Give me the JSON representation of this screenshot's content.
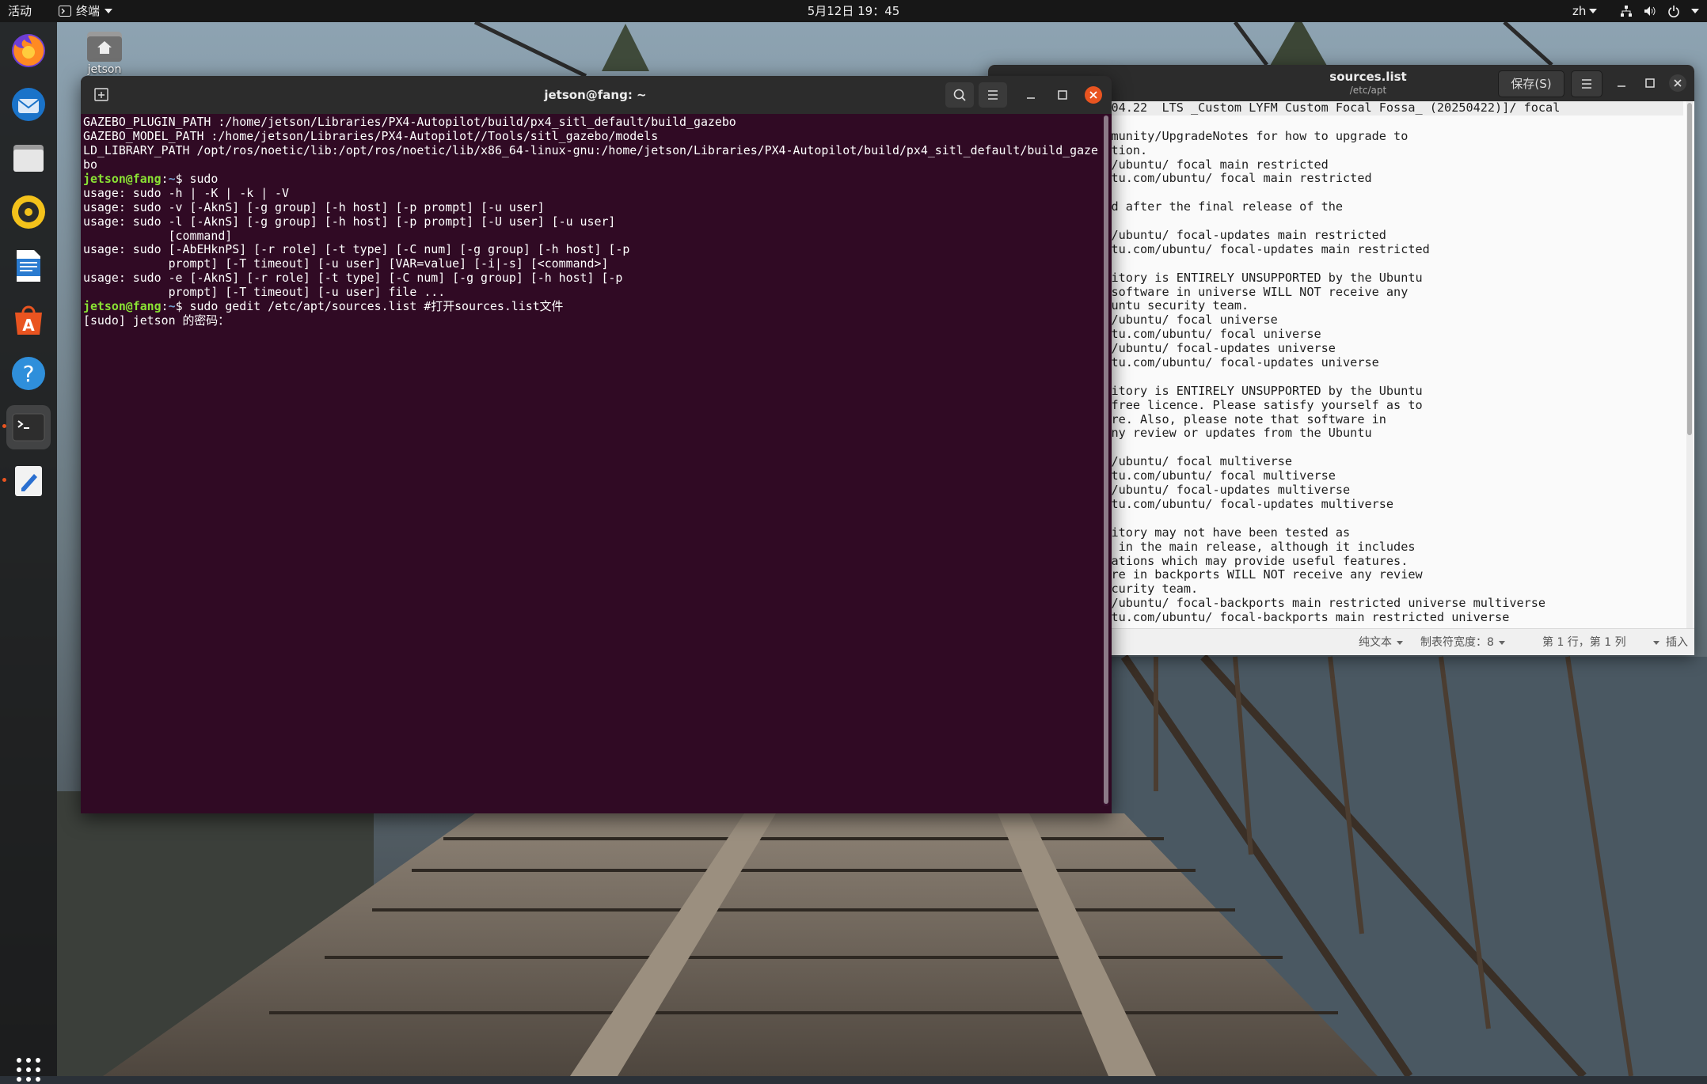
{
  "topbar": {
    "activities": "活动",
    "app_name": "终端",
    "clock": "5月12日 19：45",
    "lang": "zh"
  },
  "desktop": {
    "home_label": "jetson"
  },
  "dock": {
    "items": [
      "firefox-icon",
      "thunderbird-icon",
      "files-icon",
      "rhythmbox-icon",
      "writer-icon",
      "software-icon",
      "help-icon",
      "terminal-icon",
      "text-editor-icon"
    ]
  },
  "terminal": {
    "title": "jetson@fang: ~",
    "lines": [
      {
        "text": "GAZEBO_PLUGIN_PATH :/home/jetson/Libraries/PX4-Autopilot/build/px4_sitl_default/build_gazebo"
      },
      {
        "text": "GAZEBO_MODEL_PATH :/home/jetson/Libraries/PX4-Autopilot//Tools/sitl_gazebo/models"
      },
      {
        "text": "LD_LIBRARY_PATH /opt/ros/noetic/lib:/opt/ros/noetic/lib/x86_64-linux-gnu:/home/jetson/Libraries/PX4-Autopilot/build/px4_sitl_default/build_gaze"
      },
      {
        "text": "bo"
      },
      {
        "prompt": "jetson@fang",
        "path": "~",
        "cmd": "$ sudo"
      },
      {
        "text": "usage: sudo -h | -K | -k | -V"
      },
      {
        "text": "usage: sudo -v [-AknS] [-g group] [-h host] [-p prompt] [-u user]"
      },
      {
        "text": "usage: sudo -l [-AknS] [-g group] [-h host] [-p prompt] [-U user] [-u user]"
      },
      {
        "text": "            [command]"
      },
      {
        "text": "usage: sudo [-AbEHknPS] [-r role] [-t type] [-C num] [-g group] [-h host] [-p"
      },
      {
        "text": "            prompt] [-T timeout] [-u user] [VAR=value] [-i|-s] [<command>]"
      },
      {
        "text": "usage: sudo -e [-AknS] [-r role] [-t type] [-C num] [-g group] [-h host] [-p"
      },
      {
        "text": "            prompt] [-T timeout] [-u user] file ..."
      },
      {
        "prompt": "jetson@fang",
        "path": "~",
        "cmd": "$ sudo gedit /etc/apt/sources.list #打开sources.list文件"
      },
      {
        "text": "[sudo] jetson 的密码："
      }
    ]
  },
  "gedit": {
    "title": "sources.list",
    "subtitle": "/etc/apt",
    "save_label": "保存(S)",
    "lines": [
      "ntu 20.04.6 2025.04.22  LTS _Custom LYFM Custom Focal Fossa_ (20250422)]/ focal",
      "",
      "lp.ubuntu.com/community/UpgradeNotes for how to upgrade to",
      "s of the distribution.",
      "rchive.ubuntu.com/ubuntu/ focal main restricted",
      "//cn.archive.ubuntu.com/ubuntu/ focal main restricted",
      "",
      "x updates produced after the final release of the",
      ".",
      "rchive.ubuntu.com/ubuntu/ focal-updates main restricted",
      "//cn.archive.ubuntu.com/ubuntu/ focal-updates main restricted",
      "",
      "e from this repository is ENTIRELY UNSUPPORTED by the Ubuntu",
      "please note that software in universe WILL NOT receive any",
      "dates from the Ubuntu security team.",
      "rchive.ubuntu.com/ubuntu/ focal universe",
      "//cn.archive.ubuntu.com/ubuntu/ focal universe",
      "rchive.ubuntu.com/ubuntu/ focal-updates universe",
      "//cn.archive.ubuntu.com/ubuntu/ focal-updates universe",
      "",
      "e from this repository is ENTIRELY UNSUPPORTED by the Ubuntu",
      "y not be under a free licence. Please satisfy yourself as to",
      "to use the software. Also, please note that software in",
      "ILL NOT receive any review or updates from the Ubuntu",
      "m.",
      "rchive.ubuntu.com/ubuntu/ focal multiverse",
      "//cn.archive.ubuntu.com/ubuntu/ focal multiverse",
      "rchive.ubuntu.com/ubuntu/ focal-updates multiverse",
      "//cn.archive.ubuntu.com/ubuntu/ focal-updates multiverse",
      "",
      "e from this repository may not have been tested as",
      "as that contained in the main release, although it includes",
      "ns of some applications which may provide useful features.",
      " note that software in backports WILL NOT receive any review",
      "rom the Ubuntu security team.",
      "rchive.ubuntu.com/ubuntu/ focal-backports main restricted universe multiverse",
      "//cn.archive.ubuntu.com/ubuntu/ focal-backports main restricted universe"
    ],
    "status": {
      "syntax": "纯文本",
      "tab_width": "制表符宽度：8",
      "position": "第 1 行，第 1 列",
      "mode": "插入"
    }
  }
}
